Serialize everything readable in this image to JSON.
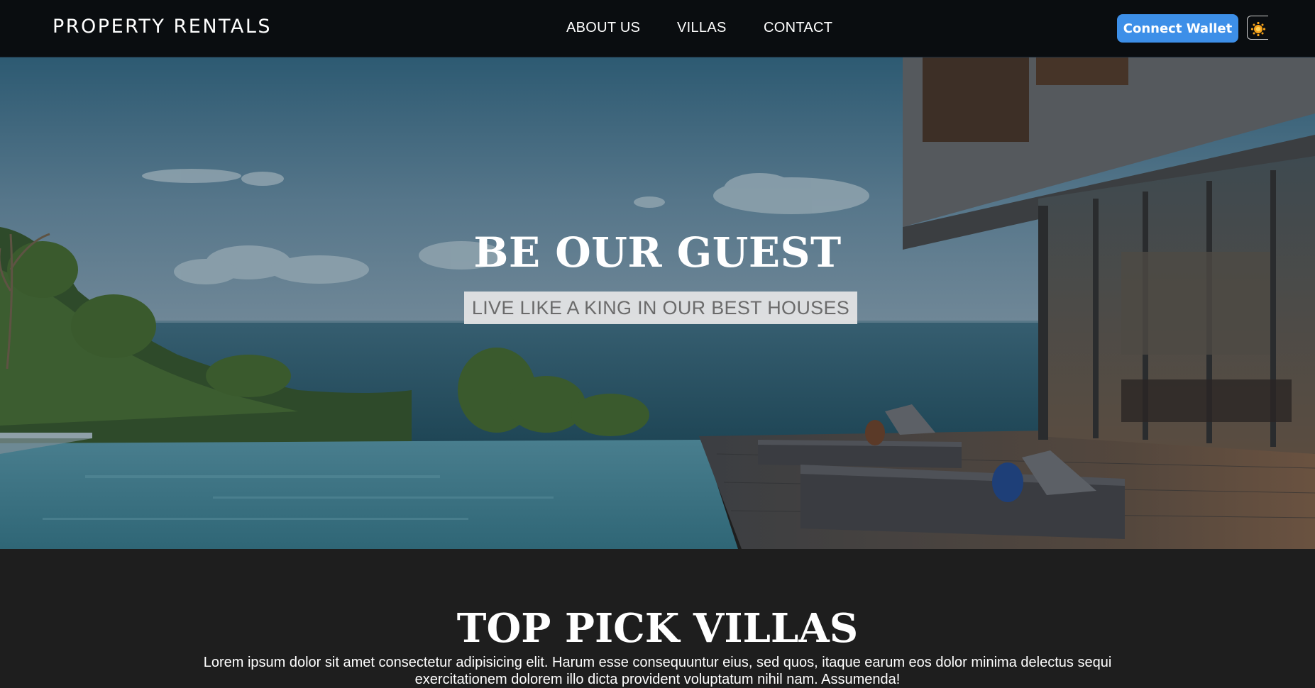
{
  "header": {
    "brand": "PROPERTY RENTALS",
    "nav": [
      "ABOUT US",
      "VILLAS",
      "CONTACT"
    ],
    "connect_wallet_label": "Connect Wallet",
    "theme_icon": "sun-icon"
  },
  "hero": {
    "title": "BE OUR GUEST",
    "subtitle": "LIVE LIKE A KING IN OUR BEST HOUSES"
  },
  "section": {
    "title": "TOP PICK VILLAS",
    "body": "Lorem ipsum dolor sit amet consectetur adipisicing elit. Harum esse consequuntur eius, sed quos, itaque earum eos dolor minima delectus sequi exercitationem dolorem illo dicta provident voluptatum nihil nam. Assumenda!"
  },
  "colors": {
    "header_bg": "#0a0d10",
    "accent_button": "#3d8fe8",
    "page_bg": "#1e1e1e",
    "sun": "#f6a21a"
  }
}
